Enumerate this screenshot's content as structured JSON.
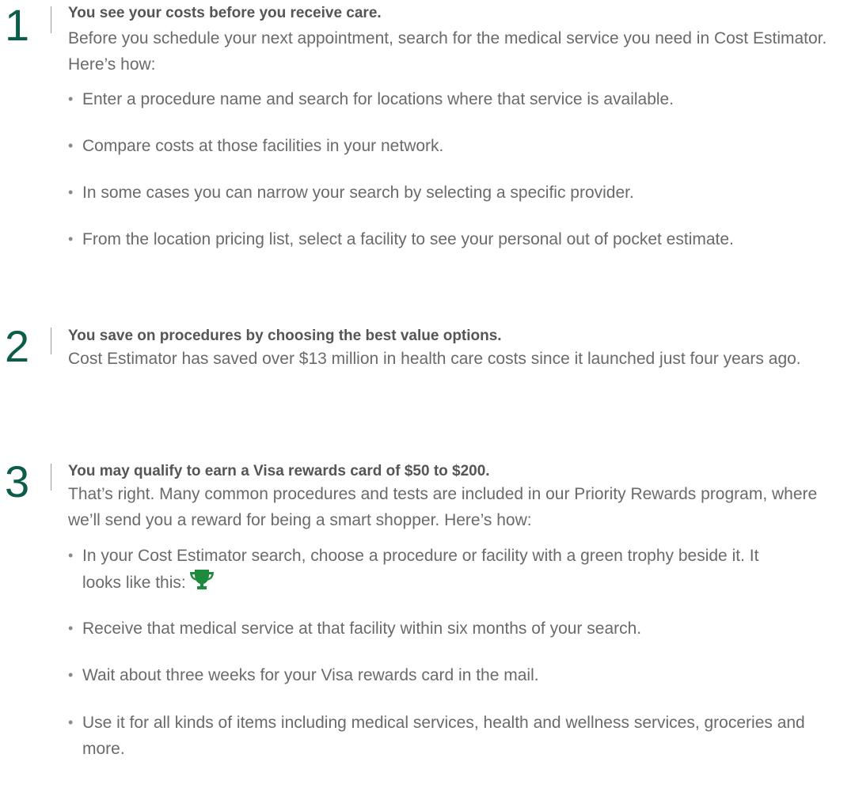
{
  "sections": [
    {
      "number": "1",
      "heading": "You see your costs before you receive care.",
      "body": "Before you schedule your next appointment, search for the medical service you need in Cost Estimator. Here’s how:",
      "bullets": [
        "Enter a procedure name and search for locations where that service is available.",
        "Compare costs at those facilities in your network.",
        "In some cases you can narrow your search by selecting a specific provider.",
        "From the location pricing list, select a facility to see your personal out of pocket estimate."
      ]
    },
    {
      "number": "2",
      "heading": "You save on procedures by choosing the best value options.",
      "body": "Cost Estimator has saved over $13 million in health care costs since it launched just four years ago."
    },
    {
      "number": "3",
      "heading": "You may qualify to earn a Visa rewards card of $50 to $200.",
      "body": "That’s right. Many common procedures and tests are included in our Priority Rewards program, where we’ll send you a reward for being a smart shopper. Here’s how:",
      "bullets": [
        "In your Cost Estimator search, choose a procedure or facility with a green trophy beside it. It looks like this:",
        "Receive that medical service at that facility within six months of your search.",
        "Wait about three weeks for your Visa rewards card in the mail.",
        "Use it for all kinds of items including medical services, health and wellness services, groceries and more."
      ]
    }
  ],
  "bullet_glyph": "•",
  "colors": {
    "number": "#0b5d4a",
    "trophy": "#1e8a3c",
    "text": "#6a6a6a"
  },
  "icons": {
    "trophy": "trophy-icon"
  }
}
